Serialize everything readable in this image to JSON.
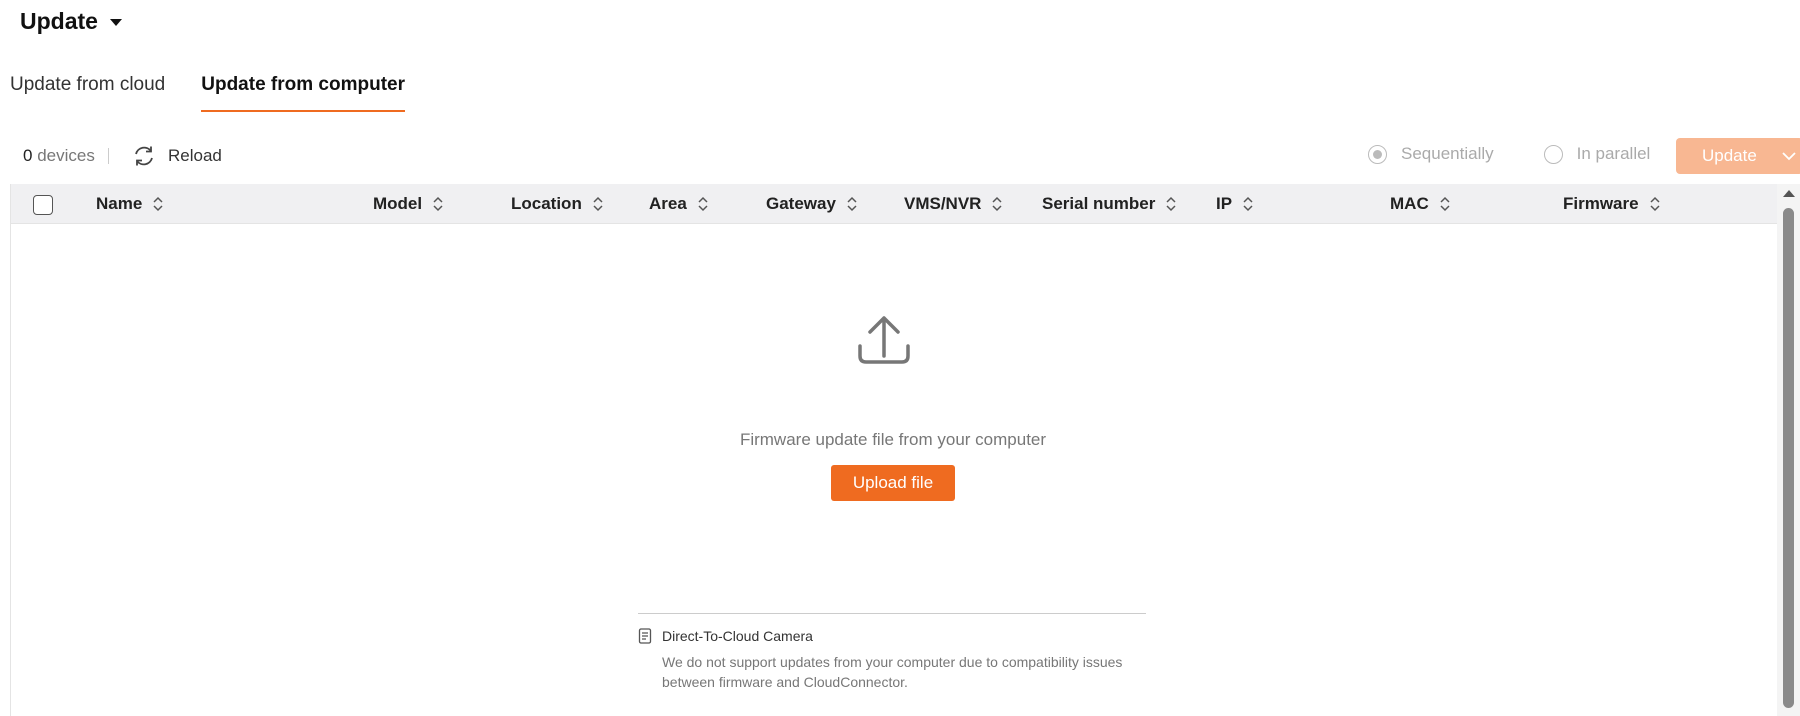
{
  "header": {
    "title": "Update"
  },
  "tabs": [
    {
      "label": "Update from cloud",
      "active": false
    },
    {
      "label": "Update from computer",
      "active": true
    }
  ],
  "toolbar": {
    "device_count": "0",
    "device_label": "devices",
    "reload_label": "Reload",
    "radio_sequential": "Sequentially",
    "radio_parallel": "In parallel",
    "selected_mode": "Sequentially",
    "update_label": "Update"
  },
  "table": {
    "columns": [
      "Name",
      "Model",
      "Location",
      "Area",
      "Gateway",
      "VMS/NVR",
      "Serial number",
      "IP",
      "MAC",
      "Firmware"
    ]
  },
  "empty_state": {
    "message": "Firmware update file from your computer",
    "upload_label": "Upload file"
  },
  "note": {
    "title": "Direct-To-Cloud Camera",
    "body": "We do not support updates from your computer due to compatibility issues between firmware and CloudConnector."
  },
  "colors": {
    "accent": "#ef6b20",
    "accent_disabled": "#f8b792",
    "header_bg": "#f0f0f2"
  }
}
